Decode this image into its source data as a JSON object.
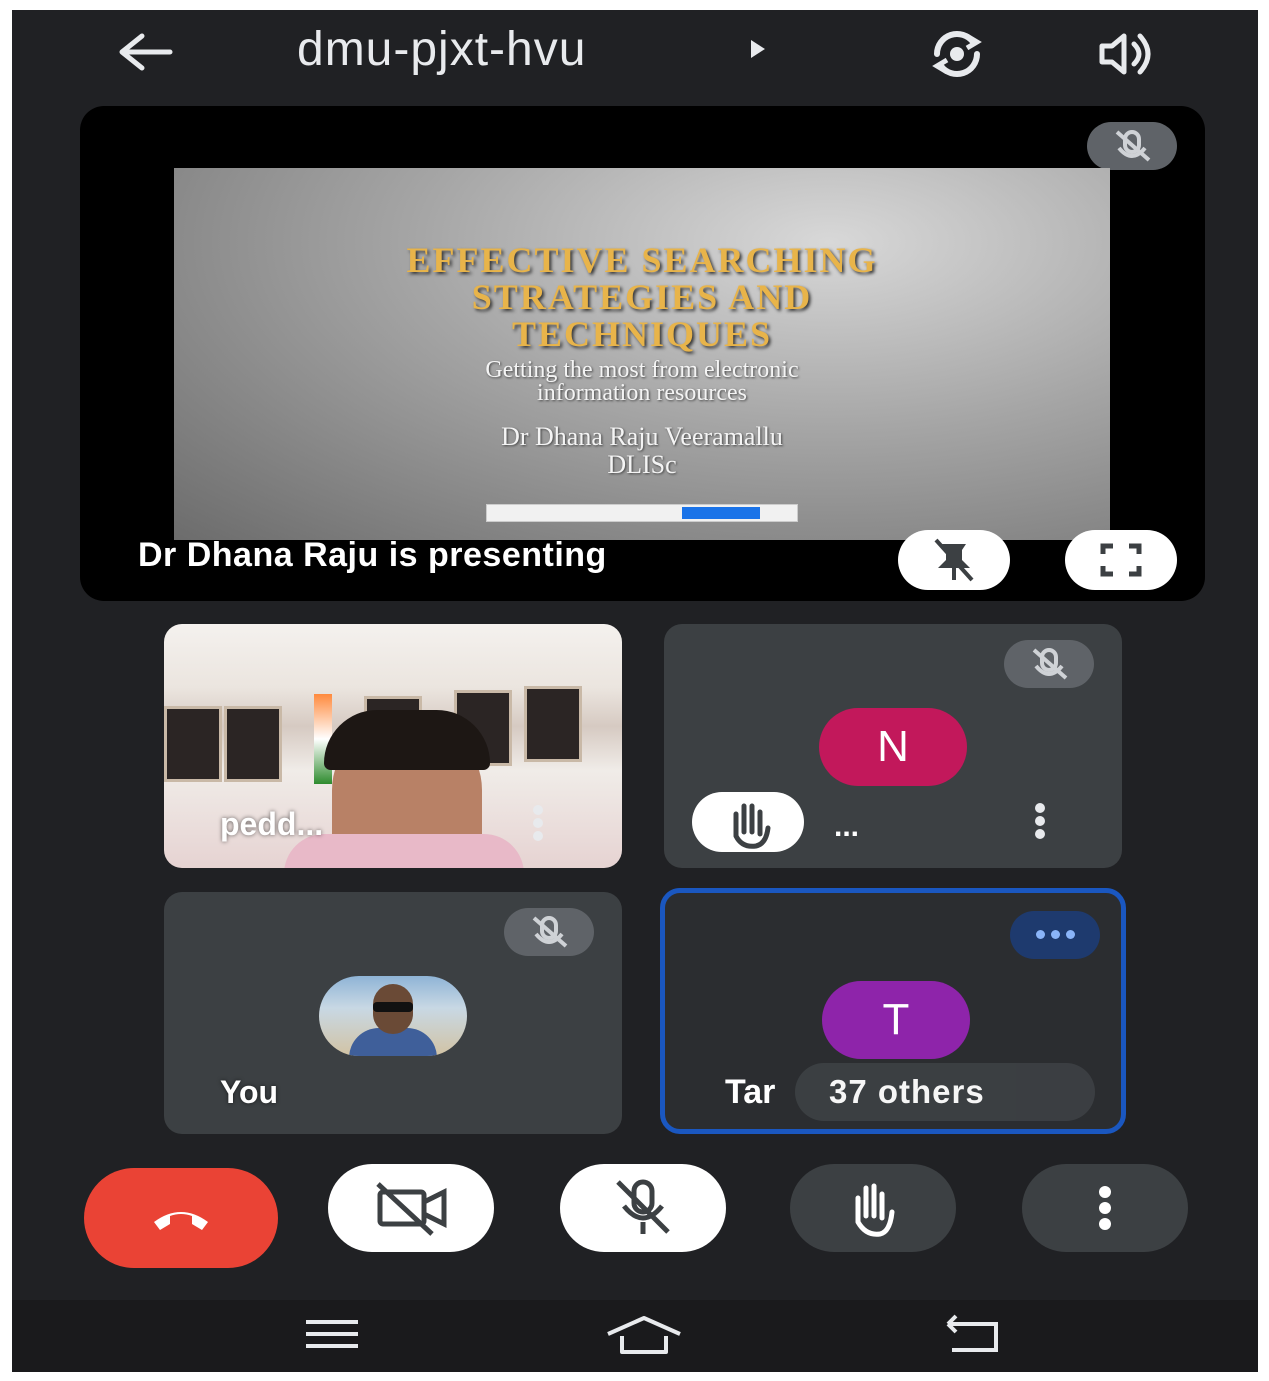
{
  "header": {
    "meeting_code": "dmu-pjxt-hvu",
    "back_icon": "arrow-left-icon",
    "caret_icon": "play-triangle-icon",
    "camera_switch_icon": "camera-flip-icon",
    "speaker_icon": "speaker-icon"
  },
  "stage": {
    "slide": {
      "title_line1": "EFFECTIVE SEARCHING",
      "title_line2": "STRATEGIES AND",
      "title_line3": "TECHNIQUES",
      "subtitle_line1": "Getting the most from electronic",
      "subtitle_line2": "information resources",
      "author_line1": "Dr Dhana Raju Veeramallu",
      "author_line2": "DLISc"
    },
    "presenting_label": "Dr Dhana Raju is presenting",
    "mic_state": "muted",
    "pin_icon": "unpin-icon",
    "fullscreen_icon": "fullscreen-icon"
  },
  "tiles": [
    {
      "name": "pedd...",
      "type": "video"
    },
    {
      "name": "...",
      "avatar_letter": "N",
      "avatar_color": "#c2185b",
      "hand_raised": true,
      "mic_state": "muted"
    },
    {
      "name": "You",
      "avatar": "photo",
      "mic_state": "muted"
    },
    {
      "name": "Tar",
      "avatar_letter": "T",
      "avatar_color": "#8e24aa",
      "others_label": "37 others",
      "active_speaker": true
    }
  ],
  "controls": {
    "end_call_icon": "end-call-icon",
    "camera_icon": "camera-off-icon",
    "mic_icon": "mic-off-icon",
    "raise_hand_icon": "raise-hand-icon",
    "more_icon": "more-vertical-icon"
  },
  "colors": {
    "background": "#202124",
    "tile": "#3c4043",
    "end_call": "#ea4335",
    "active_border": "#1a57c0",
    "slide_title": "#e8b44a"
  },
  "navbar": {
    "recents_icon": "menu-lines-icon",
    "home_icon": "home-icon",
    "back_icon": "return-icon"
  }
}
